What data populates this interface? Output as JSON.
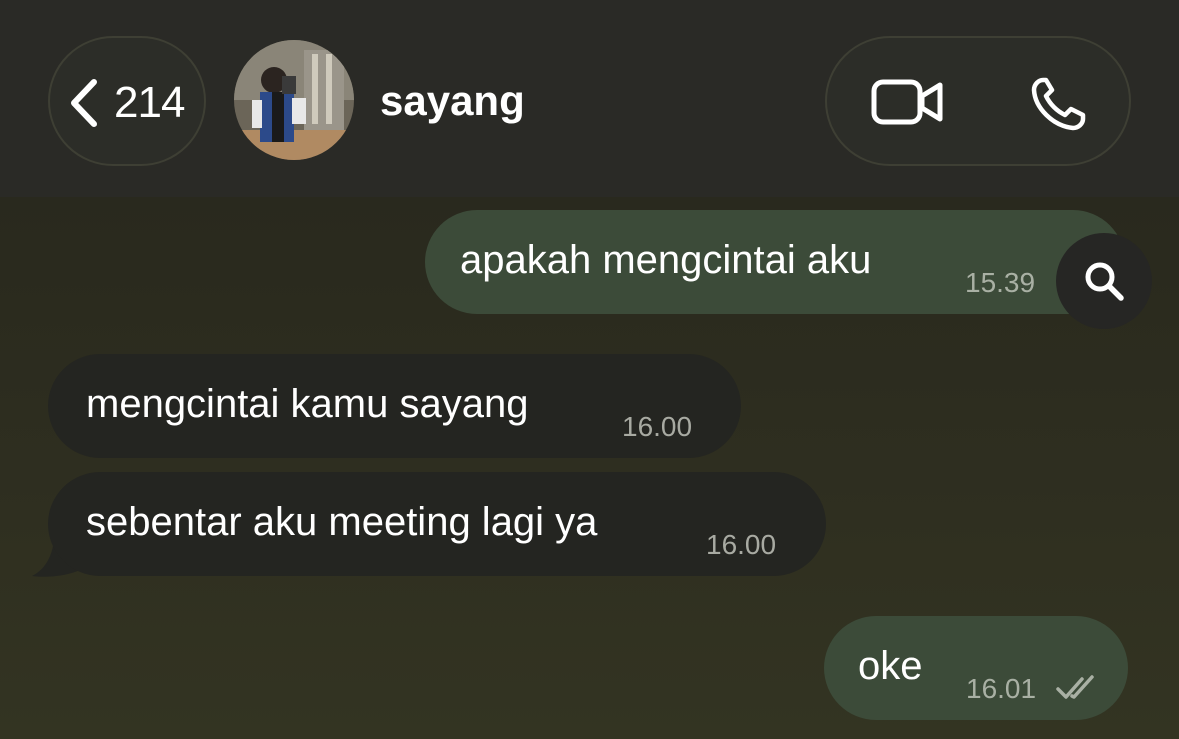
{
  "header": {
    "back_count": "214",
    "contact_name": "sayang",
    "icons": {
      "back": "chevron-left-icon",
      "video": "video-camera-icon",
      "phone": "phone-icon"
    }
  },
  "messages": [
    {
      "direction": "outgoing",
      "text": "apakah mengcintai aku",
      "time": "15.39"
    },
    {
      "direction": "incoming",
      "text": "mengcintai kamu sayang",
      "time": "16.00"
    },
    {
      "direction": "incoming",
      "text": "sebentar aku meeting lagi ya",
      "time": "16.00"
    },
    {
      "direction": "outgoing",
      "text": "oke",
      "time": "16.01",
      "status": "read-checkmark-icon"
    }
  ],
  "colors": {
    "header_bg": "#2a2a26",
    "outgoing_bubble": "#3c4b39",
    "incoming_bubble": "#242521",
    "chat_bg": "#2c2c1f"
  },
  "search_button": {
    "icon": "search-icon"
  }
}
